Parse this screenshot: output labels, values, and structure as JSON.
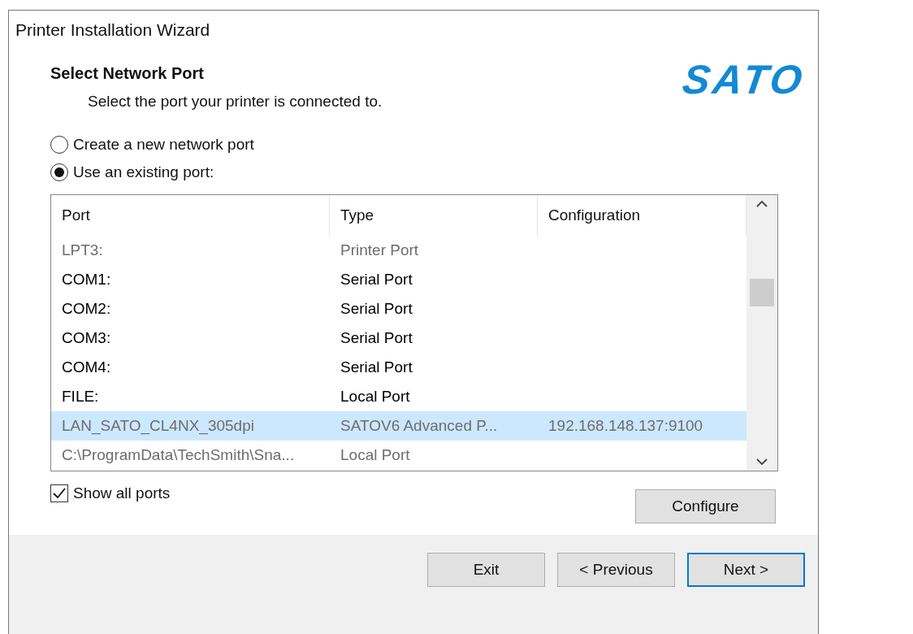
{
  "window": {
    "title": "Printer Installation Wizard"
  },
  "header": {
    "title": "Select Network Port",
    "subtitle": "Select the port your printer is connected to.",
    "logo": "SATO"
  },
  "options": [
    {
      "label": "Create a new network port",
      "selected": false
    },
    {
      "label": "Use an existing port:",
      "selected": true
    }
  ],
  "table": {
    "columns": [
      "Port",
      "Type",
      "Configuration"
    ],
    "rows": [
      {
        "cells": [
          "LPT3:",
          "Printer Port",
          ""
        ],
        "dimmed": true,
        "selected": false
      },
      {
        "cells": [
          "COM1:",
          "Serial Port",
          ""
        ],
        "dimmed": false,
        "selected": false
      },
      {
        "cells": [
          "COM2:",
          "Serial Port",
          ""
        ],
        "dimmed": false,
        "selected": false
      },
      {
        "cells": [
          "COM3:",
          "Serial Port",
          ""
        ],
        "dimmed": false,
        "selected": false
      },
      {
        "cells": [
          "COM4:",
          "Serial Port",
          ""
        ],
        "dimmed": false,
        "selected": false
      },
      {
        "cells": [
          "FILE:",
          "Local Port",
          ""
        ],
        "dimmed": false,
        "selected": false
      },
      {
        "cells": [
          "LAN_SATO_CL4NX_305dpi",
          "SATOV6 Advanced P...",
          "192.168.148.137:9100"
        ],
        "dimmed": true,
        "selected": true
      },
      {
        "cells": [
          "C:\\ProgramData\\TechSmith\\Sna...",
          "Local Port",
          ""
        ],
        "dimmed": true,
        "selected": false
      }
    ]
  },
  "show_all": {
    "label": "Show all ports",
    "checked": true
  },
  "configure_button": "Configure",
  "buttons": [
    {
      "label": "Exit",
      "kind": "normal"
    },
    {
      "label": "< Previous",
      "kind": "normal"
    },
    {
      "label": "Next >",
      "kind": "default"
    }
  ]
}
